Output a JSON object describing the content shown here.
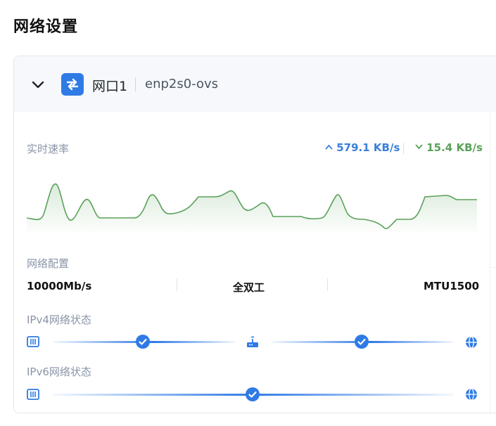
{
  "page": {
    "title": "网络设置"
  },
  "port": {
    "name": "网口1",
    "interface": "enp2s0-ovs",
    "realtime_label": "实时速率",
    "upload_rate": "579.1 KB/s",
    "download_rate": "15.4 KB/s",
    "config_label": "网络配置",
    "speed": "10000Mb/s",
    "duplex": "全双工",
    "mtu": "MTU1500",
    "ipv4_label": "IPv4网络状态",
    "ipv6_label": "IPv6网络状态"
  },
  "status": {
    "ipv4": {
      "lan_to_router": "ok",
      "router_to_internet": "ok"
    },
    "ipv6": {
      "lan_to_internet": "ok"
    }
  },
  "colors": {
    "accent": "#2f7ae5",
    "upload": "#3a7fd9",
    "download": "#5aa15a",
    "chart_line": "#5aa15a"
  },
  "icons": {
    "collapse": "chevron-down-icon",
    "port": "network-port-icon",
    "lan": "ethernet-port-icon",
    "router": "router-icon",
    "internet": "globe-icon",
    "check": "check-circle-icon"
  }
}
